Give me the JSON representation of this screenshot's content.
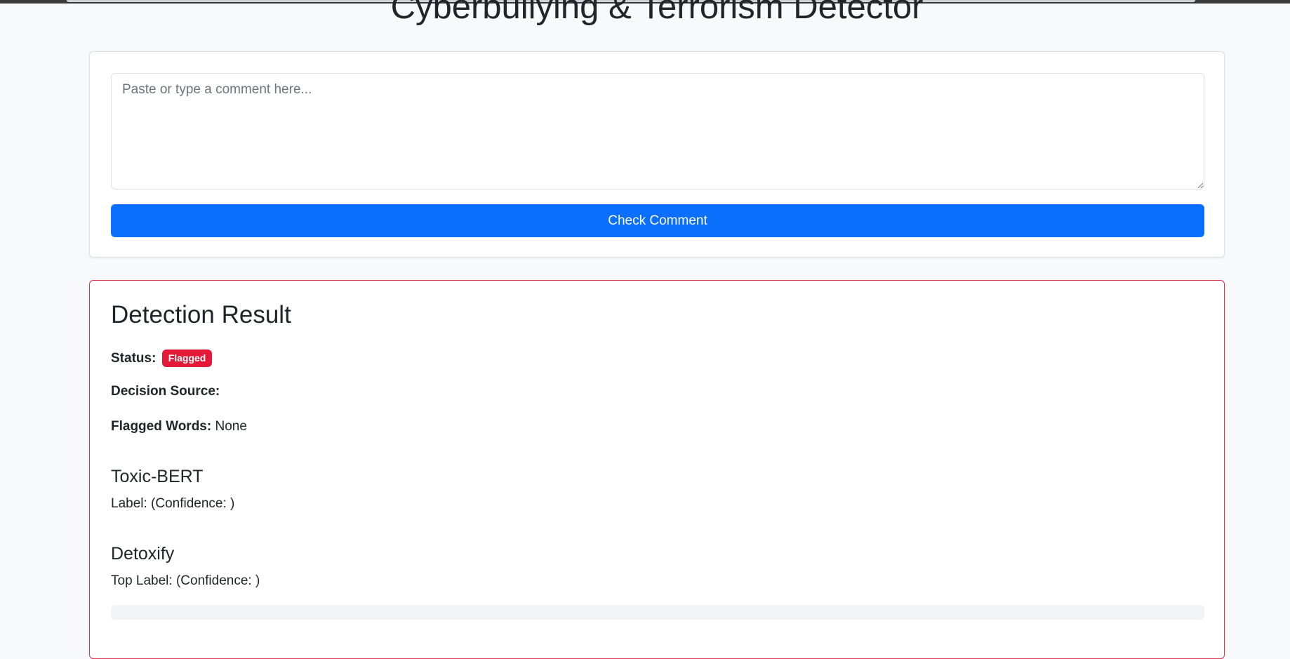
{
  "header": {
    "title": "Cyberbullying & Terrorism Detector"
  },
  "input_card": {
    "comment_placeholder": "Paste or type a comment here...",
    "comment_value": "",
    "check_button_label": "Check Comment"
  },
  "result": {
    "title": "Detection Result",
    "status_label": "Status:",
    "status_value": "Flagged",
    "status_color": "#e31937",
    "decision_source_label": "Decision Source:",
    "decision_source_value": "",
    "flagged_words_label": "Flagged Words:",
    "flagged_words_value": "None",
    "toxic_bert": {
      "title": "Toxic-BERT",
      "text": "Label: (Confidence: )"
    },
    "detoxify": {
      "title": "Detoxify",
      "text": "Top Label: (Confidence: )"
    }
  },
  "colors": {
    "primary": "#0b6ffd",
    "danger": "#dc3545",
    "background": "#f8f9fa"
  }
}
